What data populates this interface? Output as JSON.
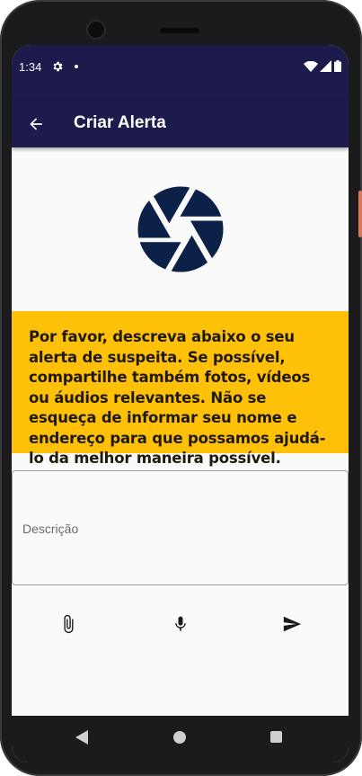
{
  "status_bar": {
    "time": "1:34",
    "background_color": "#1d1b4c",
    "icons": [
      "gear-icon",
      "notification-dot-icon",
      "wifi-icon",
      "signal-icon",
      "battery-icon"
    ]
  },
  "app_bar": {
    "title": "Criar Alerta",
    "back_icon": "arrow-back-icon",
    "background_color": "#1d1b4c"
  },
  "logo": {
    "icon": "camera-aperture-icon",
    "color": "#0c2148"
  },
  "notice": {
    "text": "Por favor, descreva abaixo o seu alerta de suspeita. Se possível, compartilhe também fotos, vídeos ou áudios relevantes. Não se esqueça de informar seu nome e endereço para que possamos ajudá-lo da melhor maneira possível.",
    "background_color": "#ffc107"
  },
  "description_field": {
    "label": "Descrição",
    "value": ""
  },
  "actions": {
    "attach_icon": "paperclip-icon",
    "record_icon": "microphone-icon",
    "send_icon": "send-icon"
  },
  "nav_bar": {
    "icons": [
      "nav-back-icon",
      "nav-home-icon",
      "nav-recents-icon"
    ]
  }
}
